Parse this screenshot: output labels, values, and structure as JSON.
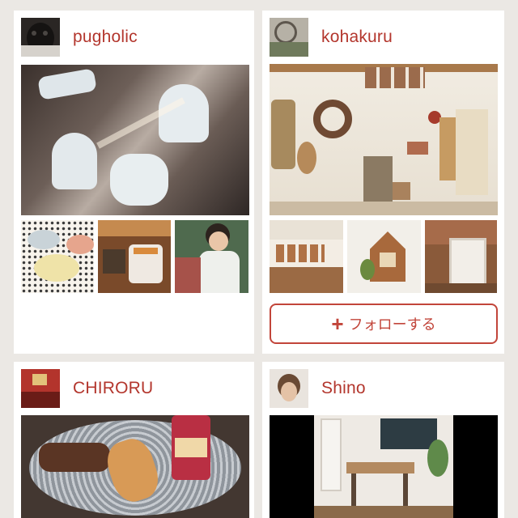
{
  "cards": [
    {
      "username": "pugholic"
    },
    {
      "username": "kohakuru",
      "follow_button": {
        "icon": "plus-icon",
        "glyph": "+",
        "label": "フォローする"
      }
    },
    {
      "username": "CHIRORU"
    },
    {
      "username": "Shino"
    }
  ],
  "colors": {
    "accent": "#c2453a",
    "username": "#b3362d",
    "background": "#ebe8e4",
    "card": "#ffffff"
  }
}
